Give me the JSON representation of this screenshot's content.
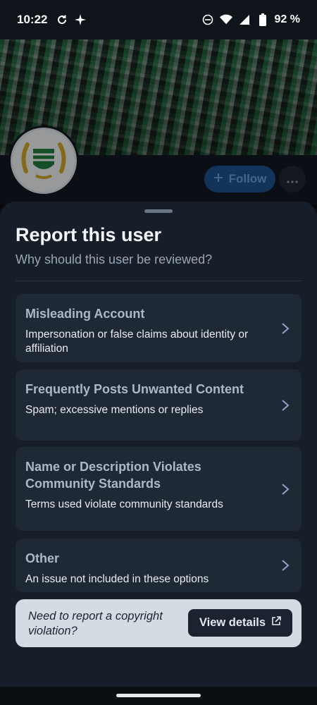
{
  "status_bar": {
    "time": "10:22",
    "battery": "92 %",
    "icons": [
      "sync-icon",
      "sparkle-icon",
      "dnd-icon",
      "wifi-icon",
      "signal-icon",
      "battery-icon"
    ]
  },
  "profile": {
    "follow_label": "Follow",
    "follow_icon": "plus-icon",
    "more_icon": "more-horizontal-icon"
  },
  "sheet": {
    "title": "Report this user",
    "subtitle": "Why should this user be reviewed?",
    "options": [
      {
        "title": "Misleading Account",
        "desc": "Impersonation or false claims about identity or affiliation"
      },
      {
        "title": "Frequently Posts Unwanted Content",
        "desc": "Spam; excessive mentions or replies"
      },
      {
        "title": "Name or Description Violates Community Standards",
        "desc": "Terms used violate community standards"
      },
      {
        "title": "Other",
        "desc": "An issue not included in these options"
      }
    ],
    "copyright": {
      "text": "Need to report a copyright violation?",
      "button_label": "View details",
      "button_icon": "external-link-icon"
    }
  },
  "colors": {
    "sheet_bg": "#161e29",
    "option_bg": "#1f2936",
    "accent_follow": "#1d4f8a",
    "copyright_bg": "#d5dbe3"
  }
}
